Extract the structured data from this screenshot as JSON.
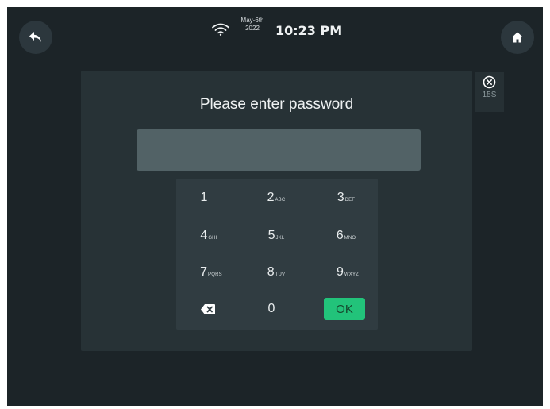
{
  "status": {
    "date_line1": "May-6th",
    "date_line2": "2022",
    "time": "10:23 PM"
  },
  "nav": {
    "back_icon": "back-arrow-icon",
    "home_icon": "home-icon"
  },
  "dialog": {
    "title": "Please enter password",
    "password_value": "",
    "close_icon": "close-circle-icon",
    "countdown": "15S"
  },
  "keypad": {
    "keys": [
      {
        "digit": "1",
        "letters": ""
      },
      {
        "digit": "2",
        "letters": "ABC"
      },
      {
        "digit": "3",
        "letters": "DEF"
      },
      {
        "digit": "4",
        "letters": "GHI"
      },
      {
        "digit": "5",
        "letters": "JKL"
      },
      {
        "digit": "6",
        "letters": "MNO"
      },
      {
        "digit": "7",
        "letters": "PQRS"
      },
      {
        "digit": "8",
        "letters": "TUV"
      },
      {
        "digit": "9",
        "letters": "WXYZ"
      },
      {
        "digit": "0",
        "letters": ""
      }
    ],
    "backspace_icon": "backspace-icon",
    "ok_label": "OK"
  },
  "colors": {
    "background": "#1c2428",
    "panel": "#273236",
    "keypad": "#303c41",
    "field": "#526266",
    "ok": "#22c37a"
  }
}
